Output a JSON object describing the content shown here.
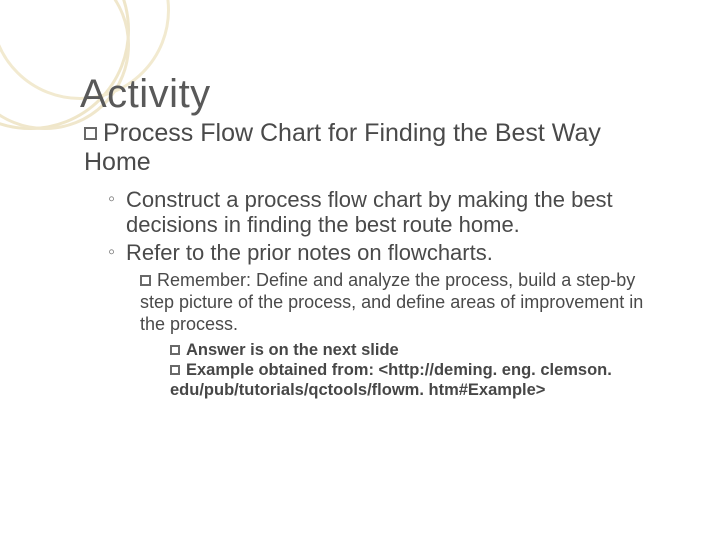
{
  "title": "Activity",
  "level1": "Process Flow Chart for Finding the Best Way Home",
  "level2": {
    "item1": "Construct a process flow chart by making the best decisions in finding the best route home.",
    "item2": "Refer to the prior notes on flowcharts."
  },
  "level3": "Remember:  Define and analyze the process, build a step-by step picture of the process, and define areas of improvement in the process.",
  "level4": {
    "item1": "Answer is on the next slide",
    "item2": "Example obtained from: <http://deming. eng. clemson. edu/pub/tutorials/qctools/flowm. htm#Example>"
  },
  "bullets": {
    "angle": "◦"
  }
}
